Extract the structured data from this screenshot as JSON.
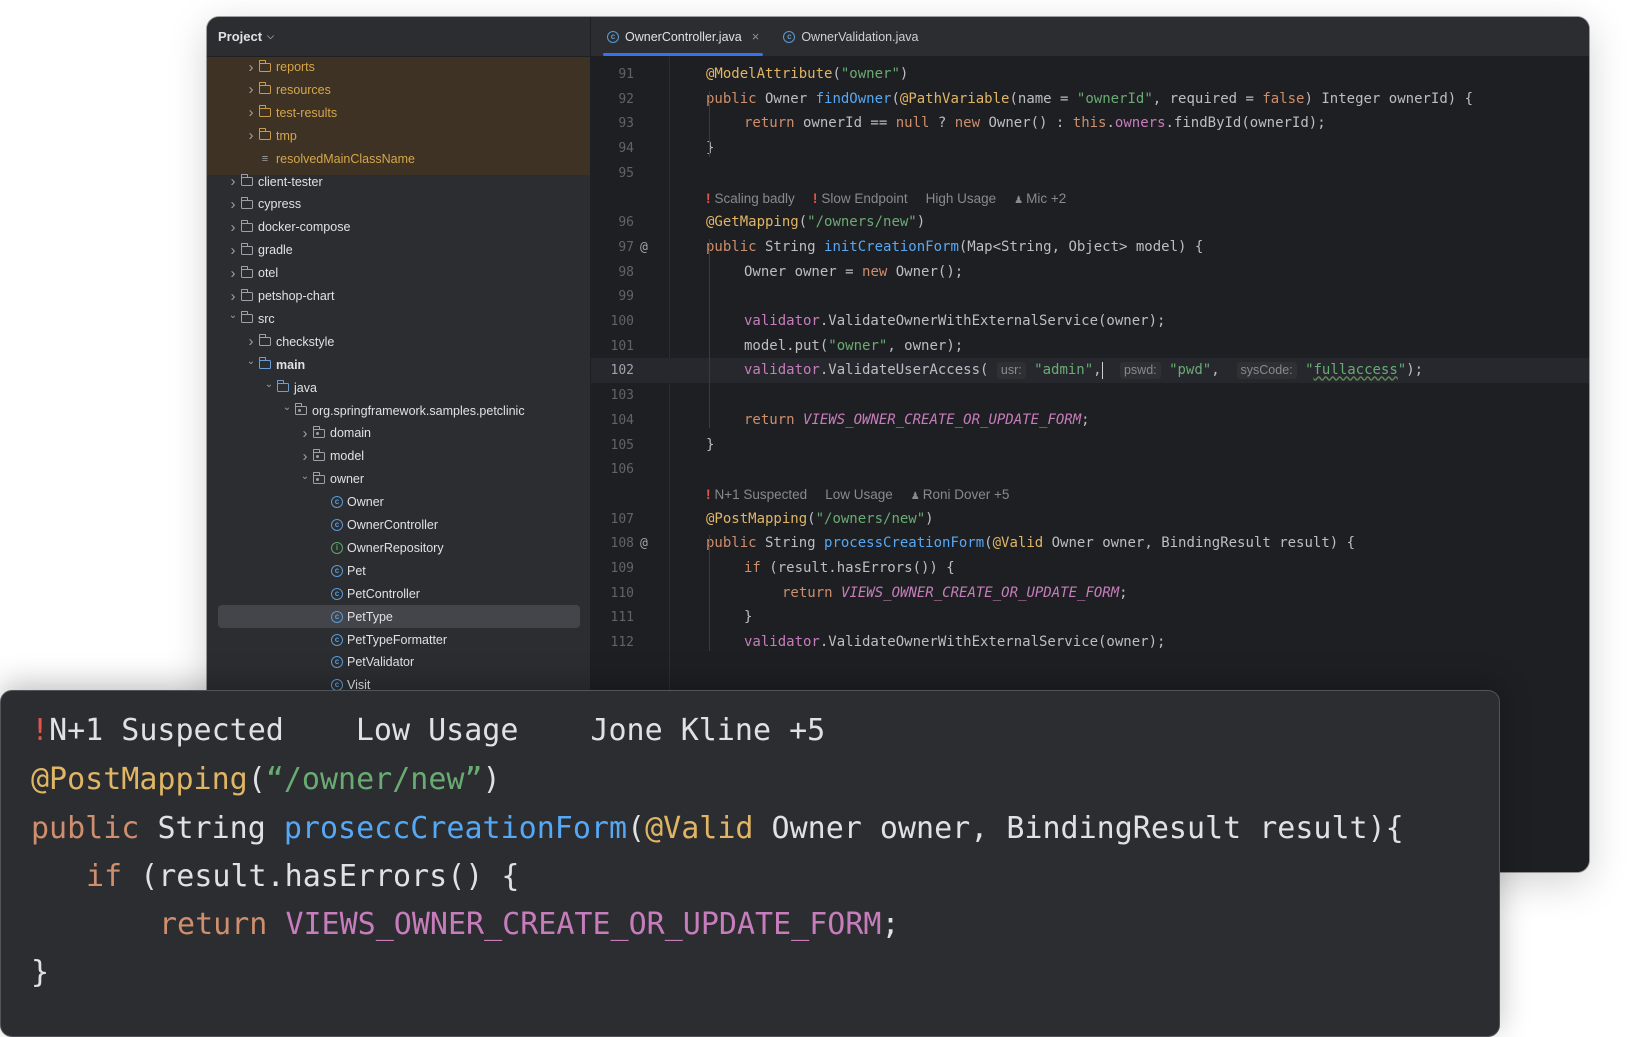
{
  "project_panel": {
    "title": "Project",
    "rows": [
      {
        "label": "reports",
        "kind": "folder",
        "depth": 3,
        "arrow": ">",
        "excluded": true
      },
      {
        "label": "resources",
        "kind": "folder",
        "depth": 3,
        "arrow": ">",
        "excluded": true
      },
      {
        "label": "test-results",
        "kind": "folder",
        "depth": 3,
        "arrow": ">",
        "excluded": true
      },
      {
        "label": "tmp",
        "kind": "folder",
        "depth": 3,
        "arrow": ">",
        "excluded": true
      },
      {
        "label": "resolvedMainClassName",
        "kind": "file",
        "depth": 3,
        "arrow": "",
        "excluded": true
      },
      {
        "label": "client-tester",
        "kind": "folder",
        "depth": 2,
        "arrow": ">"
      },
      {
        "label": "cypress",
        "kind": "folder",
        "depth": 2,
        "arrow": ">"
      },
      {
        "label": "docker-compose",
        "kind": "folder",
        "depth": 2,
        "arrow": ">"
      },
      {
        "label": "gradle",
        "kind": "folder",
        "depth": 2,
        "arrow": ">"
      },
      {
        "label": "otel",
        "kind": "folder",
        "depth": 2,
        "arrow": ">"
      },
      {
        "label": "petshop-chart",
        "kind": "folder",
        "depth": 2,
        "arrow": ">"
      },
      {
        "label": "src",
        "kind": "folder",
        "depth": 2,
        "arrow": "v"
      },
      {
        "label": "checkstyle",
        "kind": "folder",
        "depth": 3,
        "arrow": ">"
      },
      {
        "label": "main",
        "kind": "srcfolder",
        "depth": 3,
        "arrow": "v",
        "bold": true
      },
      {
        "label": "java",
        "kind": "srcfolder",
        "depth": 4,
        "arrow": "v"
      },
      {
        "label": "org.springframework.samples.petclinic",
        "kind": "package",
        "depth": 5,
        "arrow": "v"
      },
      {
        "label": "domain",
        "kind": "package",
        "depth": 6,
        "arrow": ">"
      },
      {
        "label": "model",
        "kind": "package",
        "depth": 6,
        "arrow": ">"
      },
      {
        "label": "owner",
        "kind": "package",
        "depth": 6,
        "arrow": "v"
      },
      {
        "label": "Owner",
        "kind": "class",
        "depth": 7,
        "arrow": ""
      },
      {
        "label": "OwnerController",
        "kind": "class",
        "depth": 7,
        "arrow": ""
      },
      {
        "label": "OwnerRepository",
        "kind": "interface",
        "depth": 7,
        "arrow": ""
      },
      {
        "label": "Pet",
        "kind": "class",
        "depth": 7,
        "arrow": ""
      },
      {
        "label": "PetController",
        "kind": "class",
        "depth": 7,
        "arrow": ""
      },
      {
        "label": "PetType",
        "kind": "class",
        "depth": 7,
        "arrow": "",
        "selected": true
      },
      {
        "label": "PetTypeFormatter",
        "kind": "class",
        "depth": 7,
        "arrow": ""
      },
      {
        "label": "PetValidator",
        "kind": "class",
        "depth": 7,
        "arrow": ""
      },
      {
        "label": "Visit",
        "kind": "class",
        "depth": 7,
        "arrow": ""
      }
    ]
  },
  "tabs": [
    {
      "label": "OwnerController.java",
      "active": true,
      "close": "×"
    },
    {
      "label": "OwnerValidation.java",
      "active": false
    }
  ],
  "code_lines": [
    {
      "n": "91",
      "html": "<span class='ann'>@ModelAttribute</span>(<span class='str'>\"owner\"</span>)"
    },
    {
      "n": "92",
      "html": "<span class='kw'>public</span> Owner <span class='fn'>findOwner</span>(<span class='ann'>@PathVariable</span>(name = <span class='str'>\"ownerId\"</span>, required = <span class='kw'>false</span>) Integer ownerId) {"
    },
    {
      "n": "93",
      "indent": 1,
      "html": "<span class='kw'>return</span> ownerId == <span class='kw'>null</span> ? <span class='kw'>new</span> Owner() : <span class='kw'>this</span>.<span class='fld'>owners</span>.findById(ownerId);"
    },
    {
      "n": "94",
      "html": "}"
    },
    {
      "n": "95",
      "html": ""
    },
    {
      "insight": [
        "Scaling badly",
        "Slow Endpoint",
        "High Usage",
        "Mic +2"
      ]
    },
    {
      "n": "96",
      "html": "<span class='ann'>@GetMapping</span>(<span class='str'>\"/owners/new\"</span>)"
    },
    {
      "n": "97",
      "at": "@",
      "html": "<span class='kw'>public</span> String <span class='fn'>initCreationForm</span>(Map&lt;String, Object&gt; model) {"
    },
    {
      "n": "98",
      "indent": 1,
      "html": "Owner owner = <span class='kw'>new</span> Owner();"
    },
    {
      "n": "99",
      "html": ""
    },
    {
      "n": "100",
      "indent": 1,
      "html": "<span class='fld'>validator</span>.ValidateOwnerWithExternalService(owner);"
    },
    {
      "n": "101",
      "indent": 1,
      "html": "model.put(<span class='str'>\"owner\"</span>, owner);"
    },
    {
      "n": "102",
      "indent": 1,
      "current": true,
      "html": "<span class='fld'>validator</span>.ValidateUserAccess( <span class='hint'>usr:</span> <span class='str'>\"admin\"</span>,<span class='caret'></span>  <span class='hint'>pswd:</span> <span class='str'>\"pwd\"</span>,  <span class='hint'>sysCode:</span> <span class='str'>\"<span class='squiggle'>fullaccess</span>\"</span>);"
    },
    {
      "n": "103",
      "html": ""
    },
    {
      "n": "104",
      "indent": 1,
      "html": "<span class='kw'>return</span> <span class='const'>VIEWS_OWNER_CREATE_OR_UPDATE_FORM</span>;"
    },
    {
      "n": "105",
      "html": "}"
    },
    {
      "n": "106",
      "html": ""
    },
    {
      "insight": [
        "N+1 Suspected",
        "Low Usage",
        "Roni Dover +5"
      ],
      "bangs": 1
    },
    {
      "n": "107",
      "html": "<span class='ann'>@PostMapping</span>(<span class='str'>\"/owners/new\"</span>)"
    },
    {
      "n": "108",
      "at": "@",
      "html": "<span class='kw'>public</span> String <span class='fn'>processCreationForm</span>(<span class='ann'>@Valid</span> Owner owner, BindingResult result) {"
    },
    {
      "n": "109",
      "indent": 1,
      "html": "<span class='kw'>if</span> (result.hasErrors()) {"
    },
    {
      "n": "110",
      "indent": 2,
      "html": "<span class='kw'>return</span> <span class='const'>VIEWS_OWNER_CREATE_OR_UPDATE_FORM</span>;"
    },
    {
      "n": "111",
      "indent": 1,
      "html": "}"
    },
    {
      "n": "112",
      "indent": 1,
      "html": "<span class='fld'>validator</span>.ValidateOwnerWithExternalService(owner);"
    }
  ],
  "zoom_panel": {
    "bang": "!",
    "issue": "N+1 Suspected",
    "usage": "Low Usage",
    "users": "Jone Kline +5",
    "annotation": "@PostMapping",
    "path": "“/owner/new”",
    "kw_public": "public",
    "type_string": "String",
    "method": "proseccCreationForm",
    "valid": "@Valid",
    "params": " Owner owner, BindingResult result){",
    "kw_if": "if",
    "if_rest": " (result.hasErrors() {",
    "kw_return": "return",
    "constant": "VIEWS_OWNER_CREATE_OR_UPDATE_FORM",
    "semicolon": ";",
    "close_brace": "}"
  }
}
